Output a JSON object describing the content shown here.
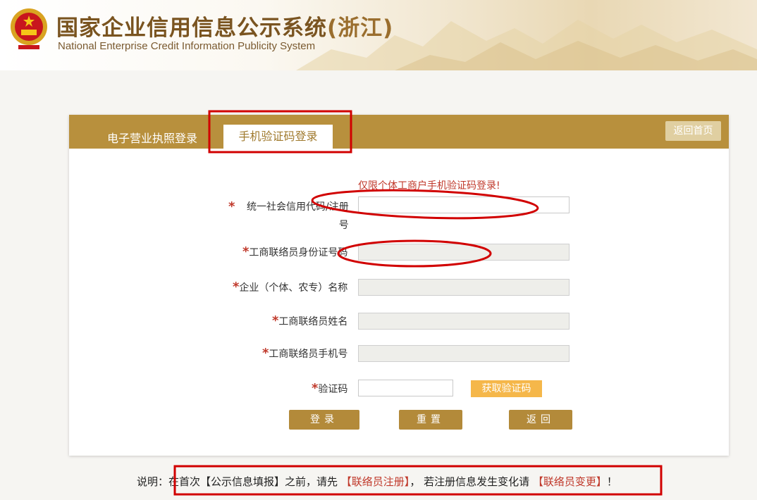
{
  "header": {
    "title_main": "国家企业信用信息公示系统",
    "title_province": "(浙江)",
    "subtitle": "National Enterprise Credit Information Publicity System"
  },
  "tabs": [
    {
      "label": "电子营业执照登录",
      "active": false
    },
    {
      "label": "手机验证码登录",
      "active": true
    }
  ],
  "home_button": "返回首页",
  "notice": "仅限个体工商户手机验证码登录!",
  "form": {
    "required_mark": "*",
    "fields": [
      {
        "label_line1": "统一社会信用代码/注册",
        "label_line2": "号",
        "value": "",
        "disabled": false
      },
      {
        "label": "工商联络员身份证号码",
        "value": "",
        "disabled": true
      },
      {
        "label": "企业（个体、农专）名称",
        "value": "",
        "disabled": true
      },
      {
        "label": "工商联络员姓名",
        "value": "",
        "disabled": true
      },
      {
        "label": "工商联络员手机号",
        "value": "",
        "disabled": true
      },
      {
        "label": "验证码",
        "value": "",
        "disabled": false
      }
    ],
    "get_code_button": "获取验证码"
  },
  "buttons": {
    "login": "登录",
    "reset": "重置",
    "back": "返回"
  },
  "footnote": {
    "prefix": "说明：在首次【公示信息填报】之前，请先",
    "link_register": "【联络员注册】",
    "middle": "，  若注册信息发生变化请",
    "link_change": "【联络员变更】",
    "suffix": "！"
  },
  "colors": {
    "tabbar": "#b8903d",
    "accent_red": "#c0392b",
    "button_brown": "#b38a3a",
    "button_orange": "#f5b74a",
    "annotation_red": "#d10000"
  }
}
